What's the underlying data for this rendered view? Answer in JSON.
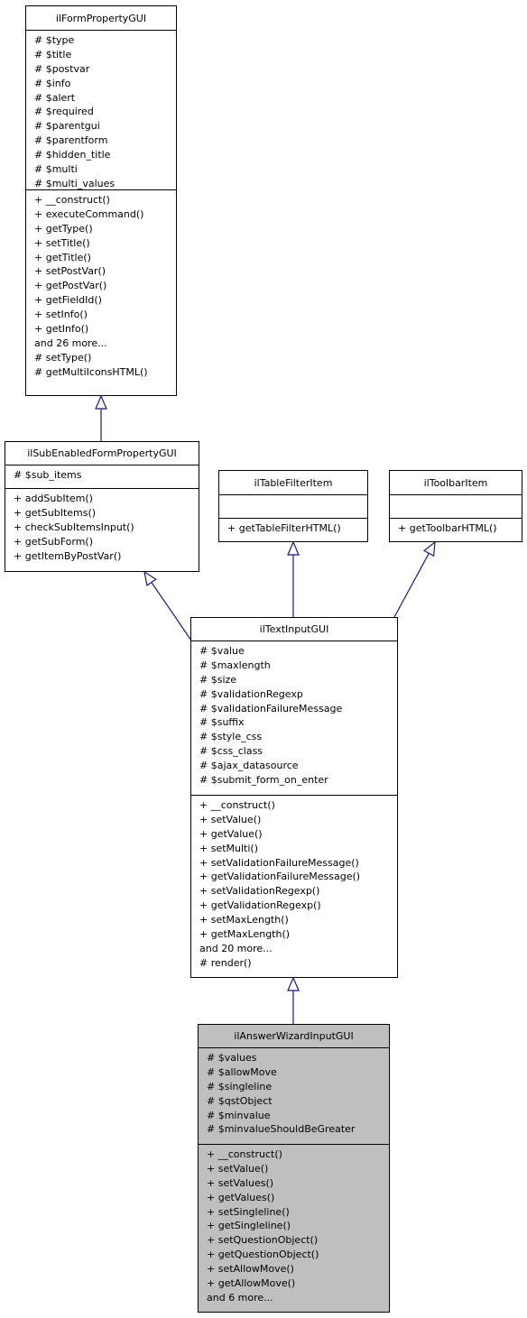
{
  "diagram": {
    "type": "class-inheritance",
    "edge_color": "#191970",
    "focus_fill": "#bfbfbf",
    "classes": [
      {
        "id": "ilFormPropertyGUI",
        "name": "ilFormPropertyGUI",
        "attributes": [
          "# $type",
          "# $title",
          "# $postvar",
          "# $info",
          "# $alert",
          "# $required",
          "# $parentgui",
          "# $parentform",
          "# $hidden_title",
          "# $multi",
          "# $multi_values"
        ],
        "methods": [
          "+ __construct()",
          "+ executeCommand()",
          "+ getType()",
          "+ setTitle()",
          "+ getTitle()",
          "+ setPostVar()",
          "+ getPostVar()",
          "+ getFieldId()",
          "+ setInfo()",
          "+ getInfo()",
          "and 26 more...",
          "# setType()",
          "# getMultiIconsHTML()"
        ]
      },
      {
        "id": "ilSubEnabledFormPropertyGUI",
        "name": "ilSubEnabledFormPropertyGUI",
        "attributes": [
          "# $sub_items"
        ],
        "methods": [
          "+ addSubItem()",
          "+ getSubItems()",
          "+ checkSubItemsInput()",
          "+ getSubForm()",
          "+ getItemByPostVar()"
        ]
      },
      {
        "id": "ilTableFilterItem",
        "name": "ilTableFilterItem",
        "attributes": [],
        "methods": [
          "+ getTableFilterHTML()"
        ]
      },
      {
        "id": "ilToolbarItem",
        "name": "ilToolbarItem",
        "attributes": [],
        "methods": [
          "+ getToolbarHTML()"
        ]
      },
      {
        "id": "ilTextInputGUI",
        "name": "ilTextInputGUI",
        "attributes": [
          "# $value",
          "# $maxlength",
          "# $size",
          "# $validationRegexp",
          "# $validationFailureMessage",
          "# $suffix",
          "# $style_css",
          "# $css_class",
          "# $ajax_datasource",
          "# $submit_form_on_enter"
        ],
        "methods": [
          "+ __construct()",
          "+ setValue()",
          "+ getValue()",
          "+ setMulti()",
          "+ setValidationFailureMessage()",
          "+ getValidationFailureMessage()",
          "+ setValidationRegexp()",
          "+ getValidationRegexp()",
          "+ setMaxLength()",
          "+ getMaxLength()",
          "and 20 more...",
          "# render()"
        ]
      },
      {
        "id": "ilAnswerWizardInputGUI",
        "name": "ilAnswerWizardInputGUI",
        "focus": true,
        "attributes": [
          "# $values",
          "# $allowMove",
          "# $singleline",
          "# $qstObject",
          "# $minvalue",
          "# $minvalueShouldBeGreater"
        ],
        "methods": [
          "+ __construct()",
          "+ setValue()",
          "+ setValues()",
          "+ getValues()",
          "+ setSingleline()",
          "+ getSingleline()",
          "+ setQuestionObject()",
          "+ getQuestionObject()",
          "+ setAllowMove()",
          "+ getAllowMove()",
          "and 6 more..."
        ]
      }
    ],
    "inheritance": [
      {
        "child": "ilSubEnabledFormPropertyGUI",
        "parent": "ilFormPropertyGUI"
      },
      {
        "child": "ilTextInputGUI",
        "parent": "ilSubEnabledFormPropertyGUI"
      },
      {
        "child": "ilTextInputGUI",
        "parent": "ilTableFilterItem"
      },
      {
        "child": "ilTextInputGUI",
        "parent": "ilToolbarItem"
      },
      {
        "child": "ilAnswerWizardInputGUI",
        "parent": "ilTextInputGUI"
      }
    ]
  }
}
